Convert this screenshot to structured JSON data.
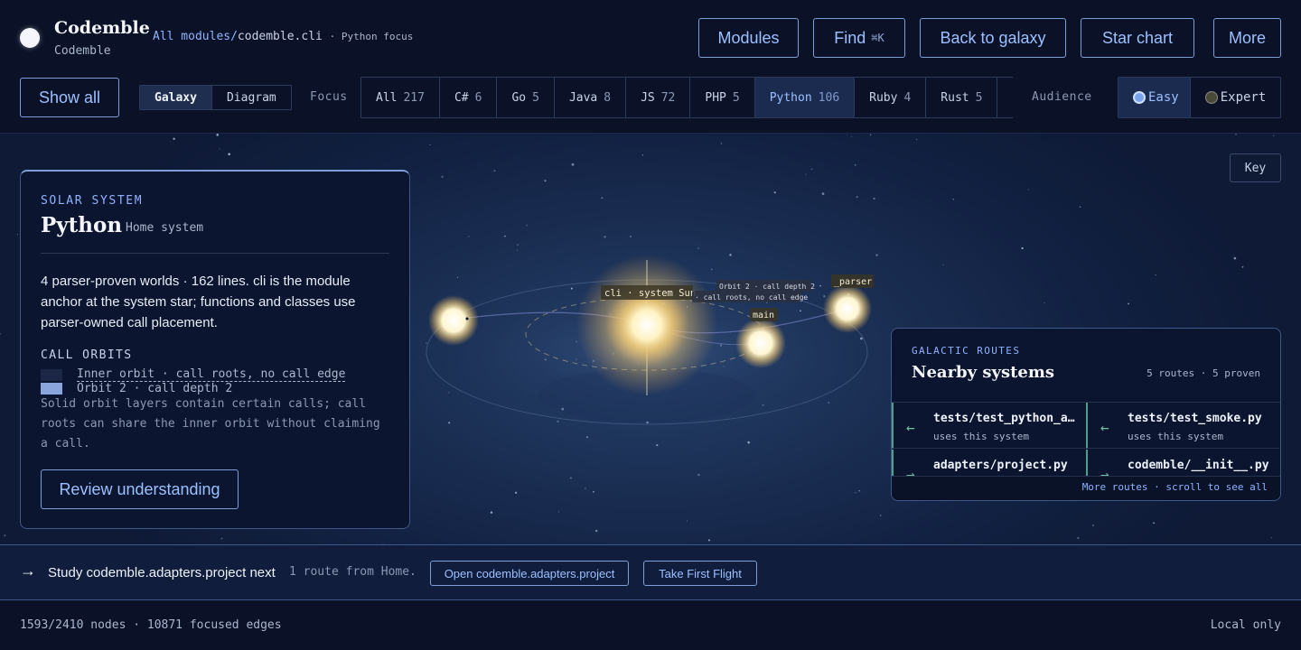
{
  "brand": {
    "title": "Codemble",
    "subtitle": "Codemble"
  },
  "breadcrumb": {
    "root": "All modules",
    "separator": "/",
    "current": "codemble.cli",
    "focus": "· Python focus"
  },
  "top_actions": {
    "modules": "Modules",
    "find": "Find",
    "find_shortcut": "⌘K",
    "back": "Back to galaxy",
    "star_chart": "Star chart",
    "more": "More"
  },
  "filter": {
    "show_all": "Show all",
    "views": [
      "Galaxy",
      "Diagram"
    ],
    "active_view": "Galaxy",
    "focus_label": "Focus",
    "languages": [
      {
        "name": "All",
        "count": "217"
      },
      {
        "name": "C#",
        "count": "6"
      },
      {
        "name": "Go",
        "count": "5"
      },
      {
        "name": "Java",
        "count": "8"
      },
      {
        "name": "JS",
        "count": "72"
      },
      {
        "name": "PHP",
        "count": "5"
      },
      {
        "name": "Python",
        "count": "106"
      },
      {
        "name": "Ruby",
        "count": "4"
      },
      {
        "name": "Rust",
        "count": "5"
      }
    ],
    "active_language": "Python",
    "audience_label": "Audience",
    "audience": [
      {
        "label": "Easy",
        "selected": true
      },
      {
        "label": "Expert",
        "selected": false
      }
    ]
  },
  "galaxy": {
    "key_button": "Key",
    "labels": {
      "sun": "cli · system Sun",
      "main": "main",
      "parser": "_parser",
      "orbit2": "Orbit 2 · call depth 2",
      "inner": "· call roots, no call edge"
    }
  },
  "solar_panel": {
    "kicker": "SOLAR SYSTEM",
    "title": "Python",
    "tag": "Home system",
    "description": "4 parser-proven worlds · 162 lines. cli is the module anchor at the system star; functions and classes use parser-owned call placement.",
    "orbits_heading": "CALL ORBITS",
    "legend": [
      {
        "label": "Inner orbit · call roots, no call edge"
      },
      {
        "label": "Orbit 2 · call depth 2"
      }
    ],
    "note": "Solid orbit layers contain certain calls; call roots can share the inner orbit without claiming a call.",
    "review_button": "Review understanding"
  },
  "routes_panel": {
    "kicker": "GALACTIC ROUTES",
    "title": "Nearby systems",
    "count": "5 routes · 5 proven",
    "routes": [
      {
        "name": "tests/test_python_adapter.py",
        "sub": "uses this system",
        "arrow": "←"
      },
      {
        "name": "tests/test_smoke.py",
        "sub": "uses this system",
        "arrow": "←"
      },
      {
        "name": "adapters/project.py",
        "sub": "",
        "arrow": "→"
      },
      {
        "name": "codemble/__init__.py",
        "sub": "",
        "arrow": "→"
      }
    ],
    "more": "More routes · scroll to see all"
  },
  "next_bar": {
    "arrow": "→",
    "text": "Study codemble.adapters.project next",
    "meta": "1 route from Home.",
    "open_button": "Open codemble.adapters.project",
    "flight_button": "Take First Flight"
  },
  "footer": {
    "stats": "1593/2410 nodes · 10871 focused edges",
    "local": "Local only"
  },
  "colors": {
    "accent": "#9cc0ff",
    "background": "#0b1228",
    "sun": "#fff3c4",
    "route_edge": "#4f9e86"
  }
}
